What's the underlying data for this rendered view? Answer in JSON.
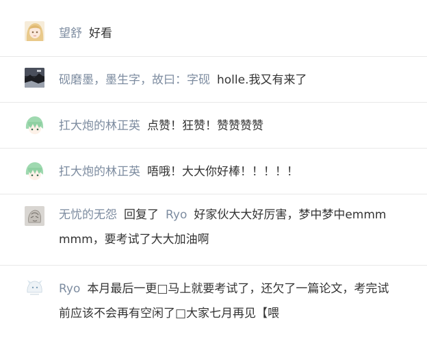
{
  "comments": [
    {
      "author": "望舒",
      "avatar_icon": "anime-blonde-avatar-icon",
      "text": "好看"
    },
    {
      "author": "砚磨墨，墨生字，故曰：字砚",
      "avatar_icon": "dark-landscape-avatar-icon",
      "text": "holle.我又有来了"
    },
    {
      "author": "扛大炮的林正英",
      "avatar_icon": "green-hair-avatar-icon",
      "text": "点赞！狂赞！赞赞赞赞"
    },
    {
      "author": "扛大炮的林正英",
      "avatar_icon": "green-hair-avatar-icon",
      "text": "唔哦！大大你好棒！！！！！"
    },
    {
      "author": "无忧的无怨",
      "avatar_icon": "sketch-avatar-icon",
      "reply_word": "回复了",
      "reply_target": "Ryo",
      "text": "好家伙大大好厉害，梦中梦中emmmmmm，要考试了大大加油啊"
    },
    {
      "author": "Ryo",
      "avatar_icon": "white-character-avatar-icon",
      "text": "本月最后一更□马上就要考试了，还欠了一篇论文，考完试前应该不会再有空闲了□大家七月再见【喂"
    }
  ]
}
